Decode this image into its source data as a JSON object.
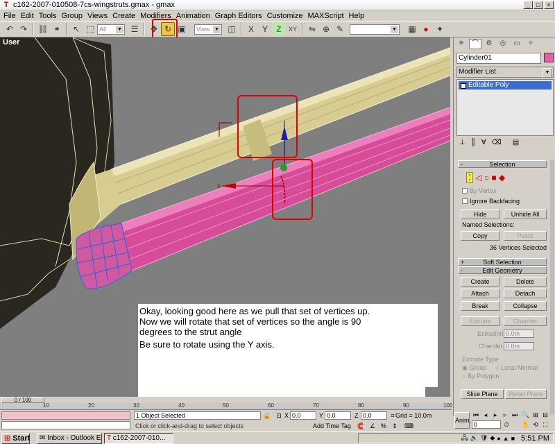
{
  "window": {
    "title": "c162-2007-010508-7cs-wingstruts.gmax - gmax",
    "min": "_",
    "max": "□",
    "close": "×"
  },
  "menu": [
    "File",
    "Edit",
    "Tools",
    "Group",
    "Views",
    "Create",
    "Modifiers",
    "Animation",
    "Graph Editors",
    "Customize",
    "MAXScript",
    "Help"
  ],
  "toolbar": {
    "filter_select": "All",
    "coord_select": "View",
    "axis_x": "X",
    "axis_y": "Y",
    "axis_z": "Z",
    "axis_xy": "XY"
  },
  "viewport": {
    "label": "User",
    "note_lines": [
      "Okay, looking good here as we pull that set of vertices up.",
      "Now we will rotate that set of vertices so the angle is 90",
      "degrees to the strut angle",
      "Be sure to rotate using the Y axis."
    ]
  },
  "command_panel": {
    "object_name": "Cylinder01",
    "modifier_list": "Modifier List",
    "stack_item": "Editable Poly",
    "selection": {
      "title": "Selection",
      "by_vertex": "By Vertex",
      "ignore_backfacing": "Ignore Backfacing",
      "hide": "Hide",
      "unhide_all": "Unhide All",
      "named_selections": "Named Selections:",
      "copy": "Copy",
      "paste": "Paste",
      "status": "36 Vertices Selected"
    },
    "soft_selection": {
      "title": "Soft Selection",
      "sign": "+"
    },
    "edit_geometry": {
      "title": "Edit Geometry",
      "sign": "-",
      "create": "Create",
      "delete": "Delete",
      "attach": "Attach",
      "detach": "Detach",
      "break": "Break",
      "collapse": "Collapse",
      "extrude": "Extrude",
      "chamfer": "Chamfer",
      "extrusion_label": "Extrusion",
      "extrusion_value": "0.0m",
      "chamfer_label": "Chamfer",
      "chamfer_value": "0.0m",
      "extrude_type": "Extrude Type",
      "group": "Group",
      "local_normal": "Local Normal",
      "by_polygon": "By Polygon",
      "slice_plane": "Slice Plane",
      "reset_plane": "Reset Plane"
    }
  },
  "timeline": {
    "slider": "0 / 100",
    "ticks": [
      "10",
      "20",
      "30",
      "40",
      "50",
      "60",
      "70",
      "80",
      "90",
      "100"
    ]
  },
  "status": {
    "objects_selected": "1 Object Selected",
    "prompt": "Click or click-and-drag to select objects",
    "x_label": "X",
    "x_value": "0.0",
    "y_label": "Y",
    "y_value": "0.0",
    "z_label": "Z",
    "z_value": "0.0",
    "grid": "Grid = 10.0m",
    "add_time_tag": "Add Time Tag",
    "anim": "Anim.",
    "frame": "0"
  },
  "taskbar": {
    "start": "Start",
    "tasks": [
      "Inbox - Outlook E...",
      "c162-2007-010..."
    ],
    "clock": "5:51 PM"
  }
}
